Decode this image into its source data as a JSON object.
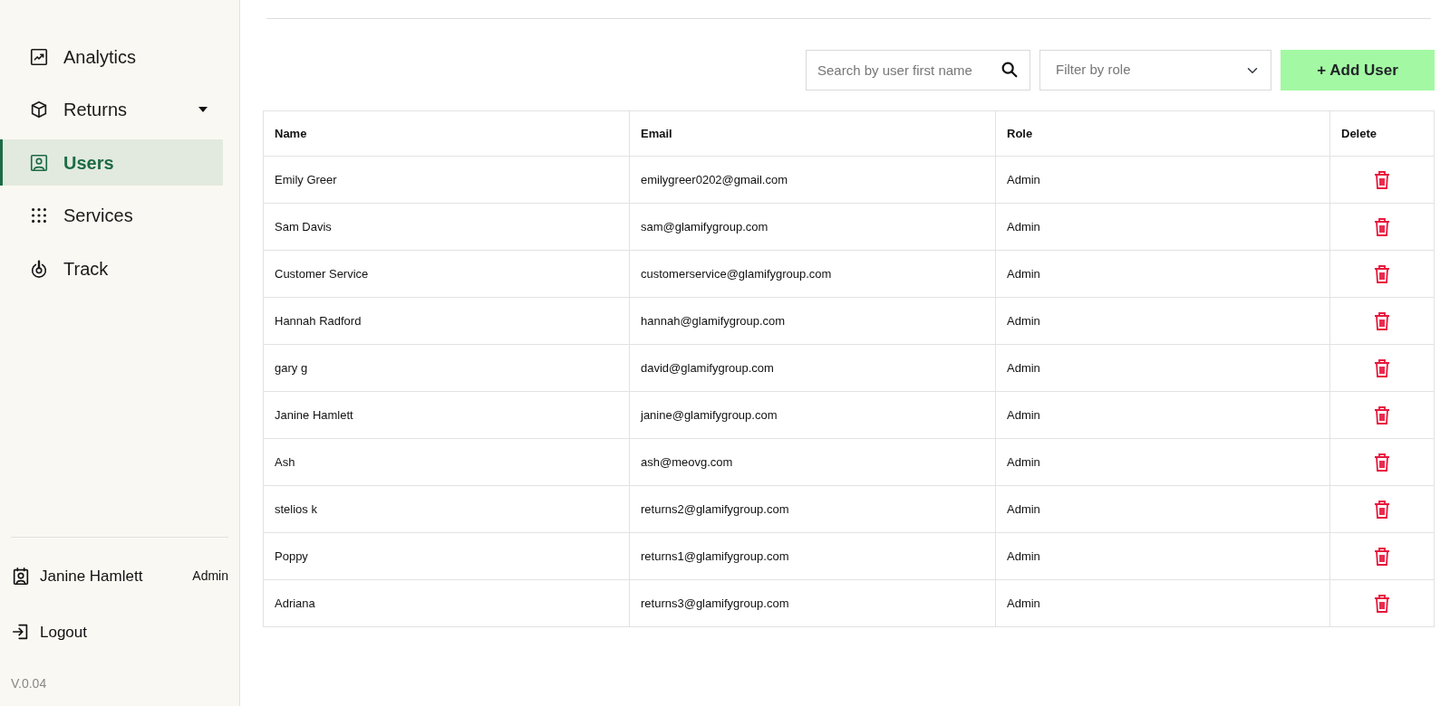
{
  "sidebar": {
    "items": [
      {
        "label": "Analytics",
        "selected": false
      },
      {
        "label": "Returns",
        "selected": false,
        "expanded": false
      },
      {
        "label": "Users",
        "selected": true
      },
      {
        "label": "Services",
        "selected": false
      },
      {
        "label": "Track",
        "selected": false
      }
    ],
    "user": {
      "name": "Janine Hamlett",
      "role": "Admin"
    },
    "logout": "Logout",
    "version": "V.0.04"
  },
  "toolbar": {
    "search": {
      "placeholder": "Search by user first name"
    },
    "filter": {
      "placeholder": "Filter by role"
    },
    "add_button": "+ Add User"
  },
  "table": {
    "columns": [
      "Name",
      "Email",
      "Role",
      "Delete"
    ],
    "rows": [
      {
        "name": "Emily Greer",
        "email": "emilygreer0202@gmail.com",
        "role": "Admin"
      },
      {
        "name": "Sam Davis",
        "email": "sam@glamifygroup.com",
        "role": "Admin"
      },
      {
        "name": "Customer Service",
        "email": "customerservice@glamifygroup.com",
        "role": "Admin"
      },
      {
        "name": "Hannah Radford",
        "email": "hannah@glamifygroup.com",
        "role": "Admin"
      },
      {
        "name": "gary g",
        "email": "david@glamifygroup.com",
        "role": "Admin"
      },
      {
        "name": "Janine Hamlett",
        "email": "janine@glamifygroup.com",
        "role": "Admin"
      },
      {
        "name": "Ash",
        "email": "ash@meovg.com",
        "role": "Admin"
      },
      {
        "name": "stelios k",
        "email": "returns2@glamifygroup.com",
        "role": "Admin"
      },
      {
        "name": "Poppy",
        "email": "returns1@glamifygroup.com",
        "role": "Admin"
      },
      {
        "name": "Adriana",
        "email": "returns3@glamifygroup.com",
        "role": "Admin"
      }
    ]
  }
}
